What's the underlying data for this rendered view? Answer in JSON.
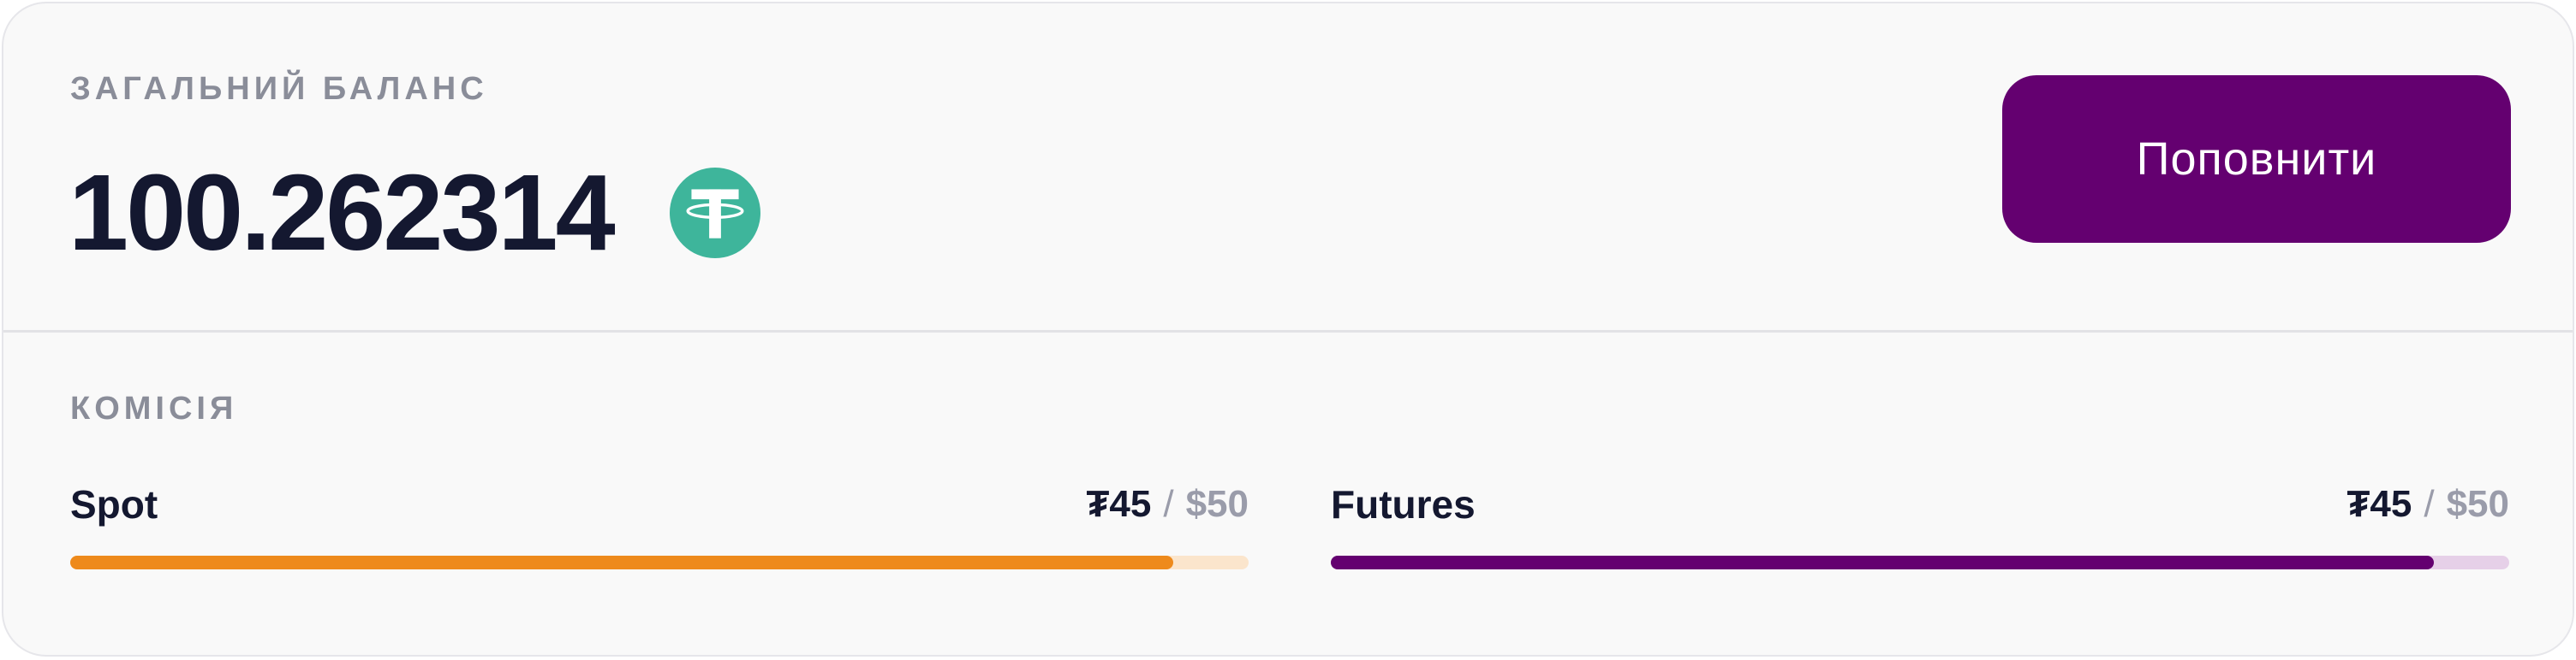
{
  "balance": {
    "label": "ЗАГАЛЬНИЙ БАЛАНС",
    "value": "100.262314",
    "currency_icon": "usdt-tether-icon",
    "icon_color": "#3eb59b"
  },
  "topup_button": {
    "label": "Поповнити",
    "color": "#640070"
  },
  "commission": {
    "label": "КОМІСІЯ",
    "items": [
      {
        "name": "Spot",
        "used": "₮45",
        "separator": "/",
        "limit": "$50",
        "progress": 0.936,
        "bar_color": "#ee8a1c",
        "track_color": "#fbe5cc"
      },
      {
        "name": "Futures",
        "used": "₮45",
        "separator": "/",
        "limit": "$50",
        "progress": 0.936,
        "bar_color": "#640070",
        "track_color": "#e6d0e8"
      }
    ]
  }
}
